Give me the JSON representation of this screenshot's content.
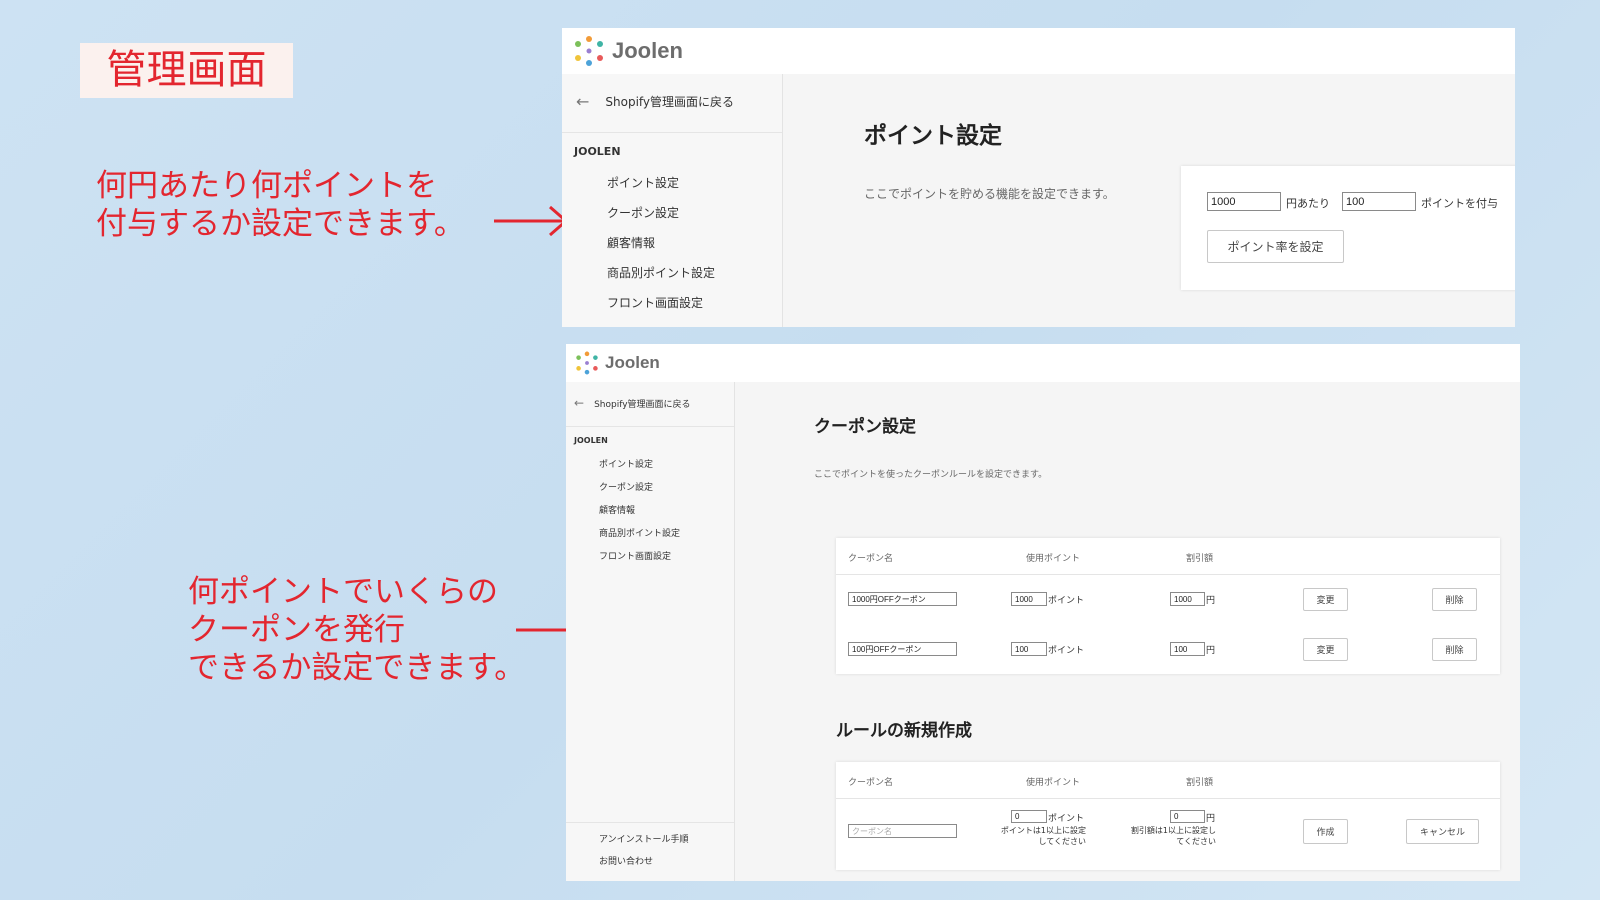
{
  "slide": {
    "title": "管理画面",
    "annotation_top": [
      "何円あたり何ポイントを",
      "付与するか設定できます。"
    ],
    "annotation_bottom": [
      "何ポイントでいくらの",
      "クーポンを発行",
      "できるか設定できます。"
    ],
    "accent_color": "#e3262f"
  },
  "app": {
    "logo_text": "Joolen",
    "back_label": "Shopify管理画面に戻る",
    "section_label": "JOOLEN",
    "nav_items": [
      "ポイント設定",
      "クーポン設定",
      "顧客情報",
      "商品別ポイント設定",
      "フロント画面設定"
    ],
    "footer_links": [
      "アンインストール手順",
      "お問い合わせ"
    ]
  },
  "points_screen": {
    "page_title": "ポイント設定",
    "description": "ここでポイントを貯める機能を設定できます。",
    "yen_value": "1000",
    "yen_suffix": "円あたり",
    "points_value": "100",
    "points_suffix": "ポイントを付与",
    "submit_label": "ポイント率を設定"
  },
  "coupon_screen": {
    "page_title": "クーポン設定",
    "description": "ここでポイントを使ったクーポンルールを設定できます。",
    "columns": [
      "クーポン名",
      "使用ポイント",
      "割引額"
    ],
    "rows": [
      {
        "name": "1000円OFFクーポン",
        "points": "1000",
        "points_unit": "ポイント",
        "discount": "1000",
        "discount_unit": "円",
        "edit_label": "変更",
        "delete_label": "削除"
      },
      {
        "name": "100円OFFクーポン",
        "points": "100",
        "points_unit": "ポイント",
        "discount": "100",
        "discount_unit": "円",
        "edit_label": "変更",
        "delete_label": "削除"
      }
    ],
    "new_rule": {
      "heading": "ルールの新規作成",
      "name_placeholder": "クーポン名",
      "points_value": "0",
      "points_unit": "ポイント",
      "points_hint": [
        "ポイントは1以上に設定",
        "してください"
      ],
      "discount_value": "0",
      "discount_unit": "円",
      "discount_hint": [
        "割引額は1以上に設定し",
        "てください"
      ],
      "create_label": "作成",
      "cancel_label": "キャンセル"
    }
  }
}
